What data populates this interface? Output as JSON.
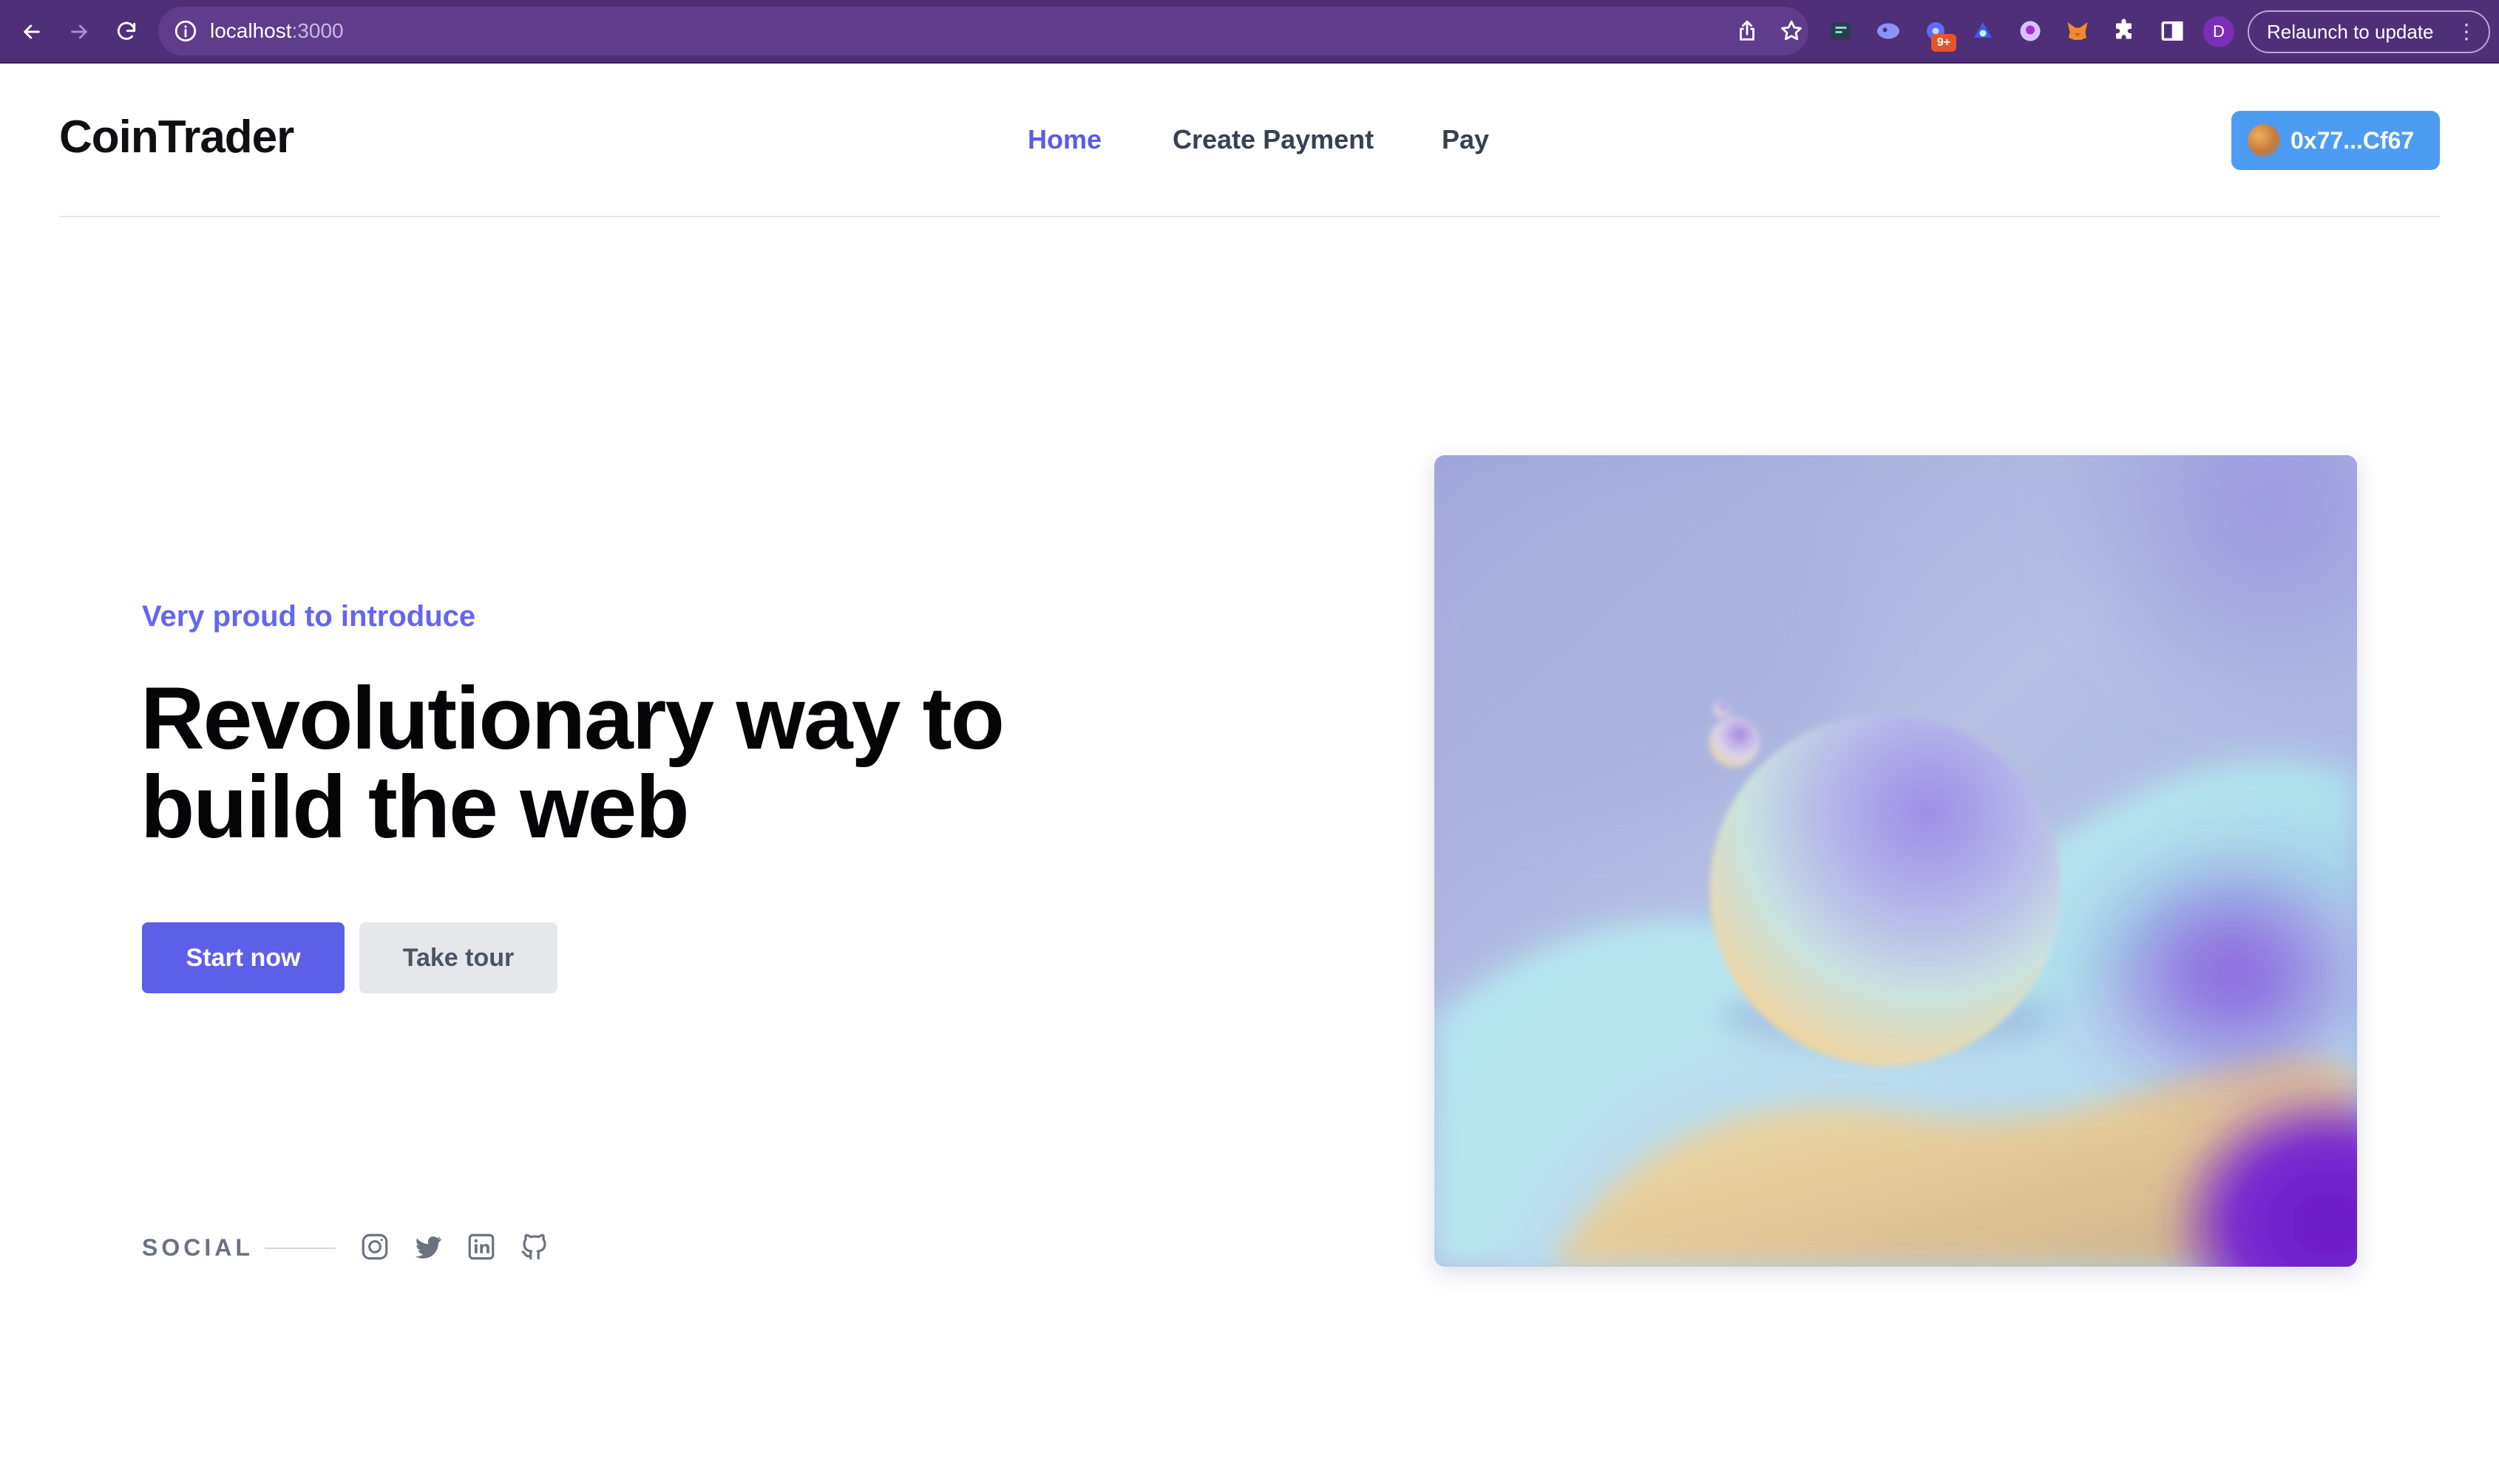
{
  "browser": {
    "url_host": "localhost",
    "url_port": ":3000",
    "extension_badge": "9+",
    "profile_initial": "D",
    "relaunch_label": "Relaunch to update",
    "menu_glyph": "⋮"
  },
  "header": {
    "logo": "CoinTrader",
    "nav": [
      {
        "label": "Home",
        "active": true
      },
      {
        "label": "Create Payment",
        "active": false
      },
      {
        "label": "Pay",
        "active": false
      }
    ],
    "wallet_address": "0x77...Cf67"
  },
  "hero": {
    "eyebrow": "Very proud to introduce",
    "headline_line1": "Revolutionary way to",
    "headline_line2": "build the web",
    "primary_button": "Start now",
    "secondary_button": "Take tour"
  },
  "social": {
    "label": "SOCIAL",
    "icons": [
      "instagram-icon",
      "twitter-icon",
      "linkedin-icon",
      "github-icon"
    ]
  },
  "colors": {
    "chrome": "#4f2f78",
    "accent": "#6366f1",
    "primary_button": "#5c5fe8",
    "wallet_button": "#4c9cf4"
  }
}
